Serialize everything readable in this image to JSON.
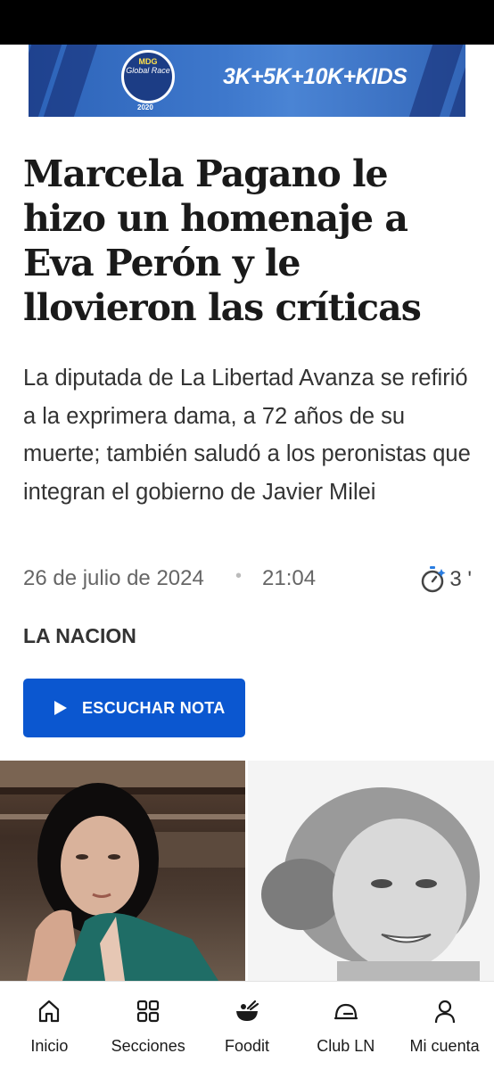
{
  "ad": {
    "brand": "MDG",
    "logo_text": "Global Race",
    "year": "2020",
    "tagline": "3K+5K+10K+KIDS"
  },
  "article": {
    "headline": "Marcela Pagano le hizo un homenaje a Eva Perón y le llovieron las críticas",
    "summary": "La diputada de La Libertad Avanza se refirió a la exprimera dama, a 72 años de su muerte; también saludó a los peronistas que integran el gobierno de Javier Milei",
    "date": "26 de julio de 2024",
    "separator": "•",
    "time": "21:04",
    "read_time": "3 '",
    "read_time_icon": "stopwatch-icon",
    "source": "LA NACION",
    "listen_label": "ESCUCHAR NOTA",
    "listen_icon": "play-icon"
  },
  "images": [
    {
      "name": "photo-marcela-pagano"
    },
    {
      "name": "photo-eva-peron"
    }
  ],
  "bottom_nav": [
    {
      "label": "Inicio",
      "icon": "home-icon"
    },
    {
      "label": "Secciones",
      "icon": "grid-icon"
    },
    {
      "label": "Foodit",
      "icon": "food-bowl-icon"
    },
    {
      "label": "Club LN",
      "icon": "club-icon"
    },
    {
      "label": "Mi cuenta",
      "icon": "user-icon"
    }
  ],
  "colors": {
    "accent": "#0b57d0",
    "text": "#1a1a1a",
    "muted": "#666666",
    "stopwatch_accent": "#2a7de1"
  }
}
